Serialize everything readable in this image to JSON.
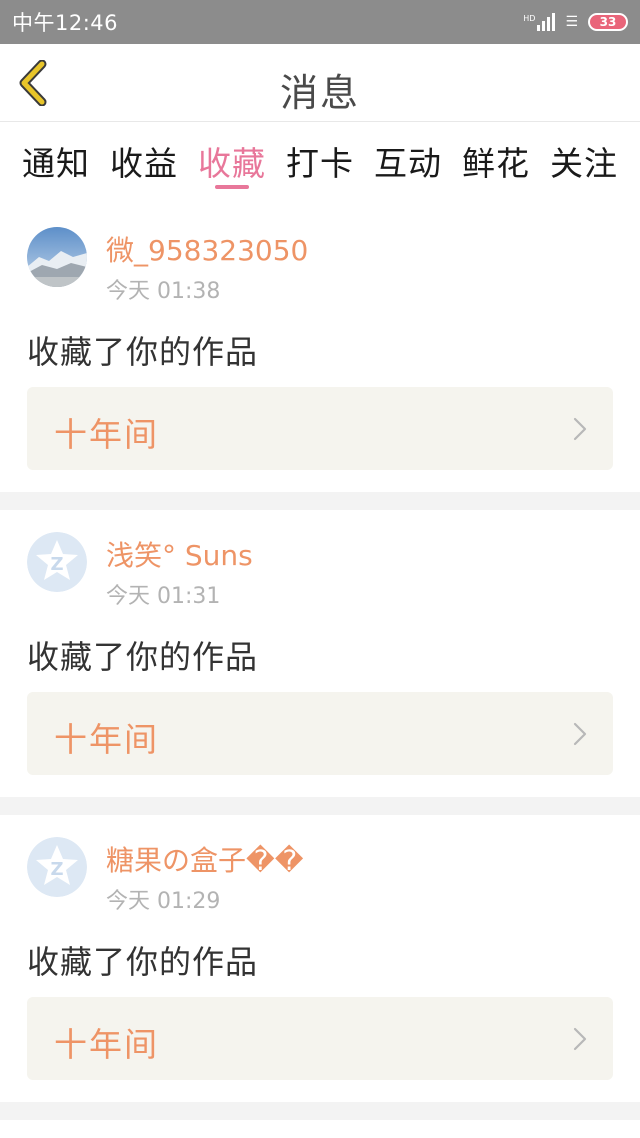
{
  "status_bar": {
    "time": "中午12:46",
    "hd": "HD",
    "battery": "33"
  },
  "nav": {
    "title": "消息",
    "back_icon": "chevron-left-icon"
  },
  "tabs": [
    {
      "label": "通知",
      "active": false
    },
    {
      "label": "收益",
      "active": false
    },
    {
      "label": "收藏",
      "active": true
    },
    {
      "label": "打卡",
      "active": false
    },
    {
      "label": "互动",
      "active": false
    },
    {
      "label": "鲜花",
      "active": false
    },
    {
      "label": "关注",
      "active": false
    }
  ],
  "colors": {
    "accent_pink": "#e8779a",
    "username_orange": "#ee9466",
    "back_yellow": "#e8c52a"
  },
  "messages": [
    {
      "username": "微_958323050",
      "time": "今天 01:38",
      "action": "收藏了你的作品",
      "work_title": "十年间",
      "avatar": "mountain-photo-avatar"
    },
    {
      "username": "浅笑° Suns",
      "time": "今天 01:31",
      "action": "收藏了你的作品",
      "work_title": "十年间",
      "avatar": "default-star-avatar"
    },
    {
      "username": "糖果の盒子��",
      "time": "今天 01:29",
      "action": "收藏了你的作品",
      "work_title": "十年间",
      "avatar": "default-star-avatar"
    }
  ]
}
